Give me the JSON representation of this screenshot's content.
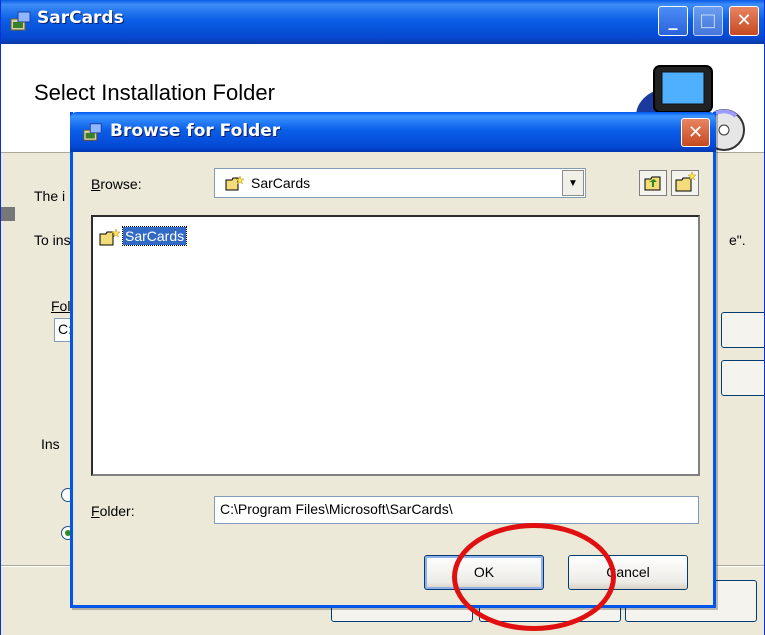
{
  "main_window": {
    "title": "SarCards",
    "header_title": "Select Installation Folder",
    "controls": {
      "minimize": "_",
      "maximize": "□",
      "close": "✕"
    },
    "partial_text": [
      "The i",
      "To ins",
      "e\".",
      "Fol",
      "C:",
      "Ins"
    ]
  },
  "browse_dialog": {
    "title": "Browse for Folder",
    "close": "✕",
    "browse_label_prefix": "B",
    "browse_label_rest": "rowse:",
    "browse_value": "SarCards",
    "tree_item": "SarCards",
    "folder_label_prefix": "F",
    "folder_label_rest": "older:",
    "folder_value": "C:\\Program Files\\Microsoft\\SarCards\\",
    "ok_label": "OK",
    "cancel_label": "Cancel",
    "combo_arrow": "▼"
  },
  "annotation": {
    "color": "#e01010",
    "target": "ok-button"
  },
  "colors": {
    "titlebar": "#0a5fe6",
    "selection": "#316ac5",
    "dialog_face": "#ece9d8"
  }
}
